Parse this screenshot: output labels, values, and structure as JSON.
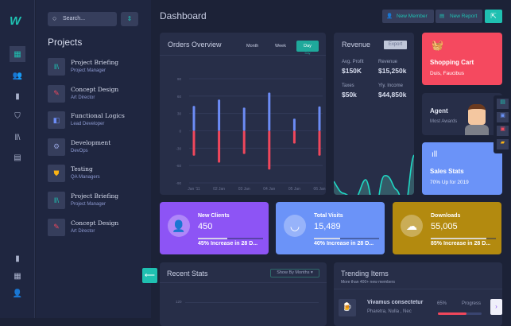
{
  "brand": "W",
  "search": {
    "placeholder": "Search..."
  },
  "sidebar": {
    "title": "Projects",
    "items": [
      {
        "title": "Project Briefing",
        "subtitle": "Project Manager",
        "icon": "books-icon",
        "color": "#1fc0b1"
      },
      {
        "title": "Concept Design",
        "subtitle": "Art Director",
        "icon": "pencil-icon",
        "color": "#f0475c"
      },
      {
        "title": "Functional Logics",
        "subtitle": "Lead Developer",
        "icon": "layers-icon",
        "color": "#6c8cf5"
      },
      {
        "title": "Development",
        "subtitle": "DevOps",
        "icon": "gear-icon",
        "color": "#8e9bd3"
      },
      {
        "title": "Testing",
        "subtitle": "QA Managers",
        "icon": "shield-icon",
        "color": "#fbb313"
      },
      {
        "title": "Project Briefing",
        "subtitle": "Project Manager",
        "icon": "books-icon",
        "color": "#1fc0b1"
      },
      {
        "title": "Concept Design",
        "subtitle": "Art Director",
        "icon": "pencil-icon",
        "color": "#f0475c"
      }
    ]
  },
  "header": {
    "title": "Dashboard",
    "new_member": "New Member",
    "new_report": "New Report"
  },
  "orders": {
    "title": "Orders Overview",
    "tabs": [
      "Month",
      "Week",
      "Day"
    ],
    "active_tab": "Day"
  },
  "chart_data": {
    "type": "bar",
    "title": "Orders Overview",
    "categories": [
      "Jan '11",
      "02 Jan",
      "03 Jan",
      "04 Jan",
      "05 Jan",
      "06 Jan"
    ],
    "series": [
      {
        "name": "positive",
        "color": "#6c8cf5",
        "values": [
          43,
          54,
          40,
          66,
          21,
          42
        ]
      },
      {
        "name": "negative",
        "color": "#f0475c",
        "values": [
          -43,
          -55,
          -40,
          -67,
          -22,
          -43
        ]
      }
    ],
    "yticks": [
      90,
      60,
      30,
      0,
      -30,
      -60,
      -90
    ],
    "ylim": [
      -90,
      90
    ],
    "grid": true
  },
  "revenue": {
    "title": "Revenue",
    "export": "Export",
    "stats": [
      {
        "label": "Avg. Profit",
        "value": "$150K"
      },
      {
        "label": "Revenue",
        "value": "$15,250k"
      },
      {
        "label": "Taxes",
        "value": "$50k"
      },
      {
        "label": "Yly. Income",
        "value": "$44,850k"
      }
    ]
  },
  "cart": {
    "title": "Shopping Cart",
    "subtitle": "Duis, Faucibus",
    "color": "#f5495f"
  },
  "agent": {
    "title": "Agent",
    "subtitle": "Most Awards"
  },
  "sales": {
    "title": "Sales Stats",
    "subtitle": "70% Up for 2019",
    "color": "#6b93f8"
  },
  "stat_cards": [
    {
      "title": "New Clients",
      "value": "450",
      "progress": 45,
      "caption": "45% Increase in 28 D...",
      "color": "#8d54f5"
    },
    {
      "title": "Total Visits",
      "value": "15,489",
      "progress": 40,
      "caption": "40% Increase in 28 D...",
      "color": "#6b93f8"
    },
    {
      "title": "Downloads",
      "value": "55,005",
      "progress": 85,
      "caption": "85% Increase in 28 D...",
      "color": "#b38a0f"
    }
  ],
  "recent": {
    "title": "Recent Stats",
    "filter": "Show By Months",
    "tick": "120"
  },
  "trending": {
    "title": "Trending Items",
    "subtitle": "More than 400+ new members",
    "item": {
      "title": "Vivamus consectetur",
      "subtitle": "Pharetra, Nulla , Nec",
      "percent": "65%",
      "progress_label": "Progress",
      "progress": 65
    }
  }
}
